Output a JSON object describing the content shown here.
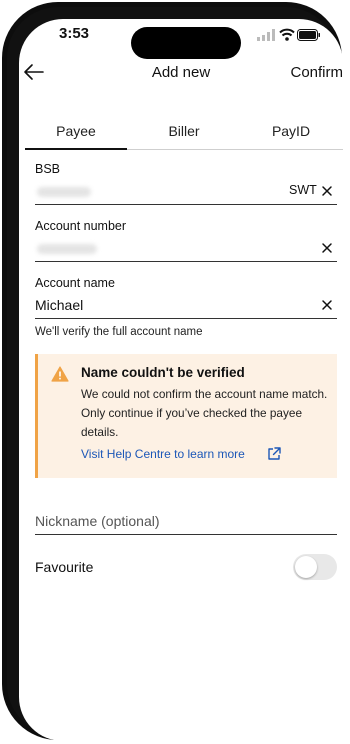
{
  "status_bar": {
    "time": "3:53"
  },
  "header": {
    "title": "Add new",
    "confirm_label": "Confirm",
    "back_icon": "arrow-left-icon"
  },
  "tabs": [
    {
      "label": "Payee",
      "active": true
    },
    {
      "label": "Biller",
      "active": false
    },
    {
      "label": "PayID",
      "active": false
    }
  ],
  "form": {
    "bsb": {
      "label": "BSB",
      "suffix": "SWT",
      "value_obscured": true
    },
    "account_number": {
      "label": "Account number",
      "value_obscured": true
    },
    "account_name": {
      "label": "Account name",
      "value": "Michael",
      "helper": "We'll verify the full account name"
    },
    "nickname": {
      "placeholder": "Nickname (optional)",
      "value": ""
    },
    "favourite": {
      "label": "Favourite",
      "on": false
    }
  },
  "alert": {
    "title": "Name couldn't be verified",
    "body": "We could not confirm the account name match. Only continue if you’ve checked the payee details.",
    "link": "Visit Help Centre to learn more",
    "icon": "warning-icon",
    "accent_color": "#f0a346",
    "background_color": "#fdf1e4",
    "link_color": "#1c57b7"
  }
}
